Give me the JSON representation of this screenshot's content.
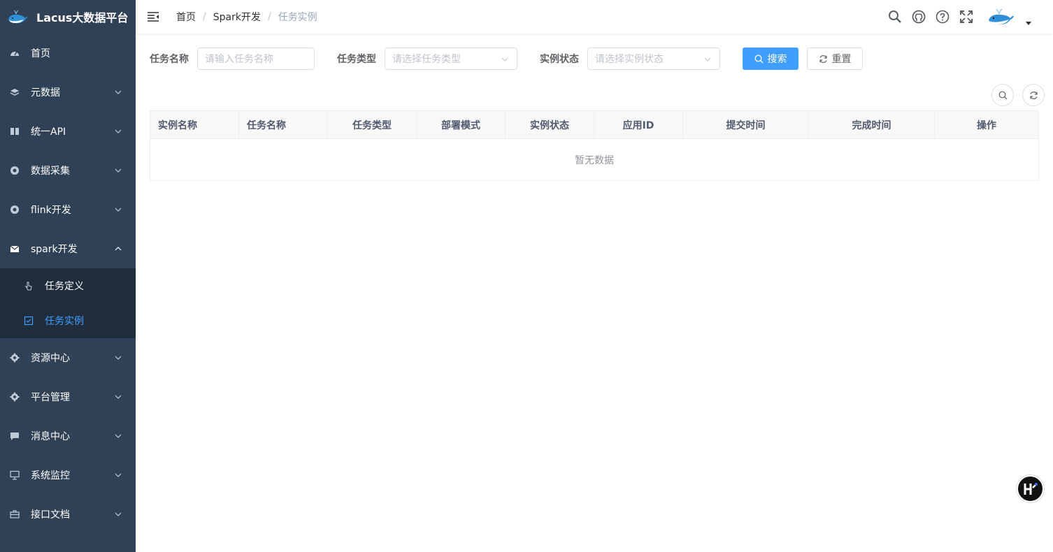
{
  "app": {
    "title": "Lacus大数据平台"
  },
  "sidebar": {
    "items": [
      {
        "label": "首页",
        "icon": "dashboard-icon",
        "has_children": false
      },
      {
        "label": "元数据",
        "icon": "layers-icon",
        "has_children": true
      },
      {
        "label": "统一API",
        "icon": "book-icon",
        "has_children": true
      },
      {
        "label": "数据采集",
        "icon": "lifebuoy-icon",
        "has_children": true
      },
      {
        "label": "flink开发",
        "icon": "lifebuoy-icon",
        "has_children": true
      },
      {
        "label": "spark开发",
        "icon": "mail-icon",
        "has_children": true,
        "expanded": true,
        "children": [
          {
            "label": "任务定义",
            "icon": "pointer-icon",
            "active": false
          },
          {
            "label": "任务实例",
            "icon": "checkbox-icon",
            "active": true
          }
        ]
      },
      {
        "label": "资源中心",
        "icon": "gear-icon",
        "has_children": true
      },
      {
        "label": "平台管理",
        "icon": "gear-icon",
        "has_children": true
      },
      {
        "label": "消息中心",
        "icon": "chat-icon",
        "has_children": true
      },
      {
        "label": "系统监控",
        "icon": "monitor-icon",
        "has_children": true
      },
      {
        "label": "接口文档",
        "icon": "briefcase-icon",
        "has_children": true
      }
    ],
    "bg_color": "#304156",
    "submenu_bg_color": "#1f2d3d",
    "active_color": "#409eff"
  },
  "navbar": {
    "breadcrumb": [
      "首页",
      "Spark开发",
      "任务实例"
    ]
  },
  "search": {
    "task_name_label": "任务名称",
    "task_name_placeholder": "请输入任务名称",
    "task_type_label": "任务类型",
    "task_type_placeholder": "请选择任务类型",
    "instance_status_label": "实例状态",
    "instance_status_placeholder": "请选择实例状态",
    "search_button": "搜索",
    "reset_button": "重置"
  },
  "table": {
    "columns": [
      "实例名称",
      "任务名称",
      "任务类型",
      "部署模式",
      "实例状态",
      "应用ID",
      "提交时间",
      "完成时间",
      "操作"
    ],
    "rows": [],
    "empty_text": "暂无数据"
  },
  "colors": {
    "primary": "#409eff",
    "header_bg": "#f8f8f9"
  }
}
